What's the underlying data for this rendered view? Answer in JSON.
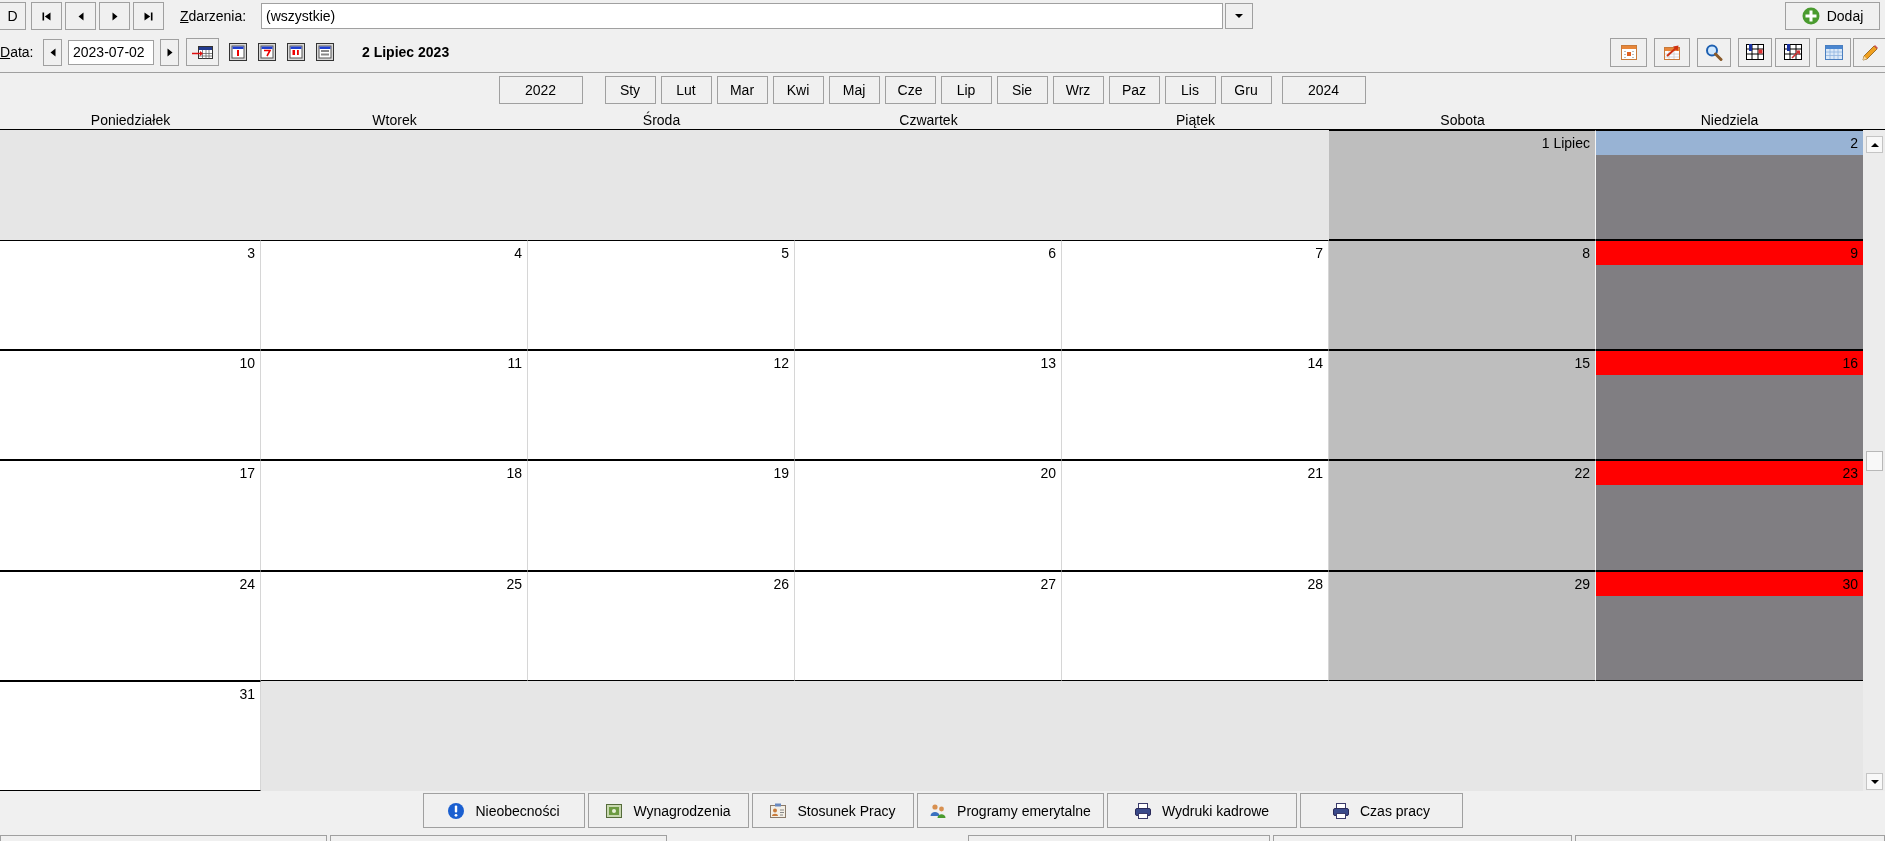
{
  "toolbar": {
    "cut_button": {
      "label": "D"
    },
    "events_filter": {
      "label": "Zdarzenia:",
      "value": "(wszystkie)"
    },
    "add_button": {
      "label": "Dodaj"
    }
  },
  "date_bar": {
    "label": "Data:",
    "date": "2023-07-02",
    "heading": "2 Lipiec 2023"
  },
  "year_nav": {
    "prev_year": "2022",
    "months": [
      "Sty",
      "Lut",
      "Mar",
      "Kwi",
      "Maj",
      "Cze",
      "Lip",
      "Sie",
      "Wrz",
      "Paz",
      "Lis",
      "Gru"
    ],
    "next_year": "2024"
  },
  "calendar": {
    "weekdays": [
      "Poniedziałek",
      "Wtorek",
      "Środa",
      "Czwartek",
      "Piątek",
      "Sobota",
      "Niedziela"
    ],
    "weeks": [
      {
        "days": [
          {
            "kind": "outside"
          },
          {
            "kind": "outside"
          },
          {
            "kind": "outside"
          },
          {
            "kind": "outside"
          },
          {
            "kind": "outside"
          },
          {
            "kind": "saturday",
            "label": "1 Lipiec",
            "selected": false
          },
          {
            "kind": "sunday",
            "label": "2",
            "selected": true
          }
        ]
      },
      {
        "days": [
          {
            "kind": "weekday",
            "label": "3",
            "selected": false
          },
          {
            "kind": "weekday",
            "label": "4",
            "selected": false
          },
          {
            "kind": "weekday",
            "label": "5",
            "selected": false
          },
          {
            "kind": "weekday",
            "label": "6",
            "selected": false
          },
          {
            "kind": "weekday",
            "label": "7",
            "selected": false
          },
          {
            "kind": "saturday",
            "label": "8",
            "selected": false
          },
          {
            "kind": "sunday",
            "label": "9",
            "selected": false
          }
        ]
      },
      {
        "days": [
          {
            "kind": "weekday",
            "label": "10",
            "selected": false
          },
          {
            "kind": "weekday",
            "label": "11",
            "selected": false
          },
          {
            "kind": "weekday",
            "label": "12",
            "selected": false
          },
          {
            "kind": "weekday",
            "label": "13",
            "selected": false
          },
          {
            "kind": "weekday",
            "label": "14",
            "selected": false
          },
          {
            "kind": "saturday",
            "label": "15",
            "selected": false
          },
          {
            "kind": "sunday",
            "label": "16",
            "selected": false
          }
        ]
      },
      {
        "days": [
          {
            "kind": "weekday",
            "label": "17",
            "selected": false
          },
          {
            "kind": "weekday",
            "label": "18",
            "selected": false
          },
          {
            "kind": "weekday",
            "label": "19",
            "selected": false
          },
          {
            "kind": "weekday",
            "label": "20",
            "selected": false
          },
          {
            "kind": "weekday",
            "label": "21",
            "selected": false
          },
          {
            "kind": "saturday",
            "label": "22",
            "selected": false
          },
          {
            "kind": "sunday",
            "label": "23",
            "selected": false
          }
        ]
      },
      {
        "days": [
          {
            "kind": "weekday",
            "label": "24",
            "selected": false
          },
          {
            "kind": "weekday",
            "label": "25",
            "selected": false
          },
          {
            "kind": "weekday",
            "label": "26",
            "selected": false
          },
          {
            "kind": "weekday",
            "label": "27",
            "selected": false
          },
          {
            "kind": "weekday",
            "label": "28",
            "selected": false
          },
          {
            "kind": "saturday",
            "label": "29",
            "selected": false
          },
          {
            "kind": "sunday",
            "label": "30",
            "selected": false
          }
        ]
      },
      {
        "days": [
          {
            "kind": "weekday",
            "label": "31",
            "selected": false
          },
          {
            "kind": "outside"
          },
          {
            "kind": "outside"
          },
          {
            "kind": "outside"
          },
          {
            "kind": "outside"
          },
          {
            "kind": "outside"
          },
          {
            "kind": "outside"
          }
        ]
      }
    ]
  },
  "bottom_buttons": [
    "Nieobecności",
    "Wynagrodzenia",
    "Stosunek Pracy",
    "Programy emerytalne",
    "Wydruki kadrowe",
    "Czas pracy"
  ]
}
